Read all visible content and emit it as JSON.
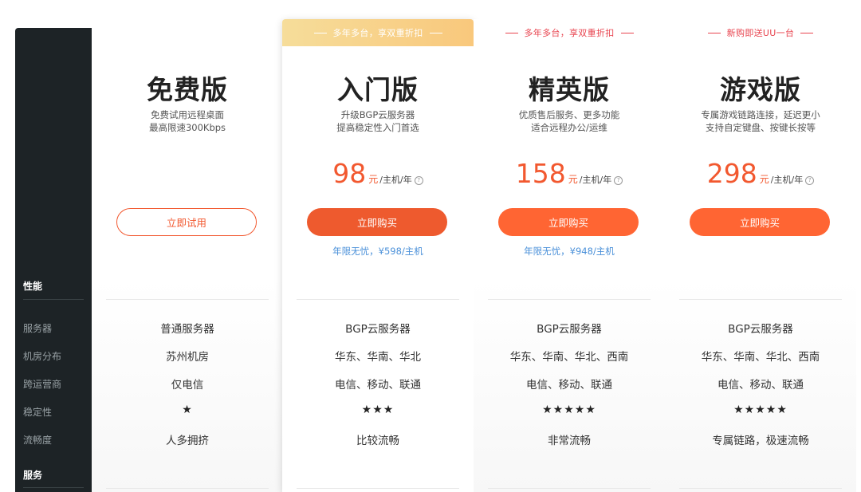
{
  "sidebar": {
    "section_performance": "性能",
    "items": [
      "服务器",
      "机房分布",
      "跨运营商",
      "稳定性",
      "流畅度"
    ],
    "section_service": "服务"
  },
  "plans": [
    {
      "banner": "",
      "name": "免费版",
      "desc1": "免费试用远程桌面",
      "desc2": "最高限速300Kbps",
      "price_amount": "",
      "price_unit": "",
      "price_per": "",
      "button": "立即试用",
      "note": "",
      "features": [
        "普通服务器",
        "苏州机房",
        "仅电信",
        "★",
        "人多拥挤"
      ]
    },
    {
      "banner": "多年多台，享双重折扣",
      "name": "入门版",
      "desc1": "升级BGP云服务器",
      "desc2": "提高稳定性入门首选",
      "price_amount": "98",
      "price_unit": "元",
      "price_per": "/主机/年",
      "button": "立即购买",
      "note": "年限无忧，¥598/主机",
      "features": [
        "BGP云服务器",
        "华东、华南、华北",
        "电信、移动、联通",
        "★★★",
        "比较流畅"
      ]
    },
    {
      "banner": "多年多台，享双重折扣",
      "name": "精英版",
      "desc1": "优质售后服务、更多功能",
      "desc2": "适合远程办公/运维",
      "price_amount": "158",
      "price_unit": "元",
      "price_per": "/主机/年",
      "button": "立即购买",
      "note": "年限无忧，¥948/主机",
      "features": [
        "BGP云服务器",
        "华东、华南、华北、西南",
        "电信、移动、联通",
        "★★★★★",
        "非常流畅"
      ]
    },
    {
      "banner": "新购即送UU一台",
      "name": "游戏版",
      "desc1": "专属游戏链路连接，延迟更小",
      "desc2": "支持自定键盘、按键长按等",
      "price_amount": "298",
      "price_unit": "元",
      "price_per": "/主机/年",
      "button": "立即购买",
      "note": "",
      "features": [
        "BGP云服务器",
        "华东、华南、华北、西南",
        "电信、移动、联通",
        "★★★★★",
        "专属链路，极速流畅"
      ]
    }
  ],
  "colors": {
    "accent": "#ff6533",
    "price": "#f2582f",
    "note": "#4a90d9",
    "sidebar": "#1d2326",
    "banner_red": "#e8444f",
    "banner_gold": "#f9c87c"
  }
}
